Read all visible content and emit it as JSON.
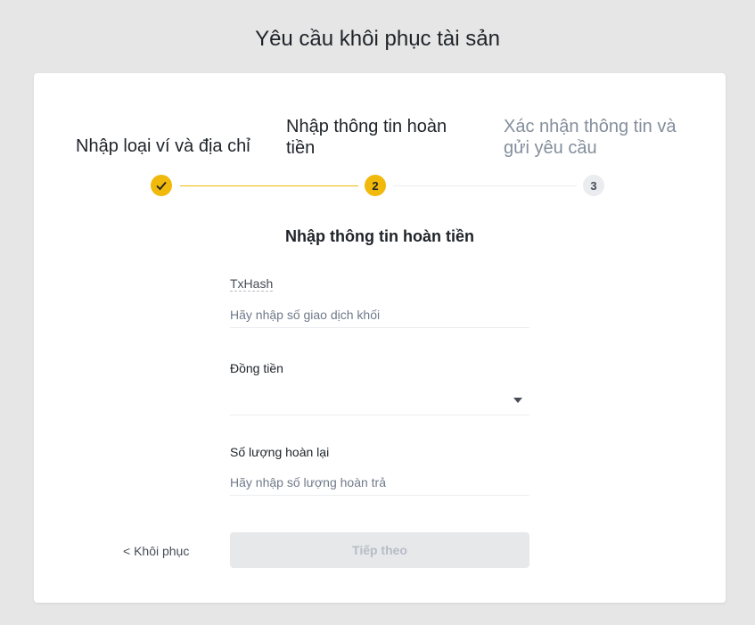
{
  "header": {
    "title": "Yêu cầu khôi phục tài sản"
  },
  "steps": [
    {
      "label": "Nhập loại ví và địa chỉ",
      "marker": "✓",
      "status": "completed"
    },
    {
      "label": "Nhập thông tin hoàn tiền",
      "marker": "2",
      "status": "active"
    },
    {
      "label": "Xác nhận thông tin và gửi yêu cầu",
      "marker": "3",
      "status": "pending"
    }
  ],
  "form": {
    "title": "Nhập thông tin hoàn tiền",
    "txhash": {
      "label": "TxHash",
      "placeholder": "Hãy nhập số giao dịch khối",
      "value": ""
    },
    "coin": {
      "label": "Đồng tiền",
      "value": ""
    },
    "amount": {
      "label": "Số lượng hoàn lại",
      "placeholder": "Hãy nhập số lượng hoàn trả",
      "value": ""
    }
  },
  "actions": {
    "back_label": "< Khôi phục",
    "next_label": "Tiếp theo"
  },
  "colors": {
    "accent": "#f0b90b",
    "pending": "#eaecef",
    "disabled_bg": "#e6e8ea"
  }
}
